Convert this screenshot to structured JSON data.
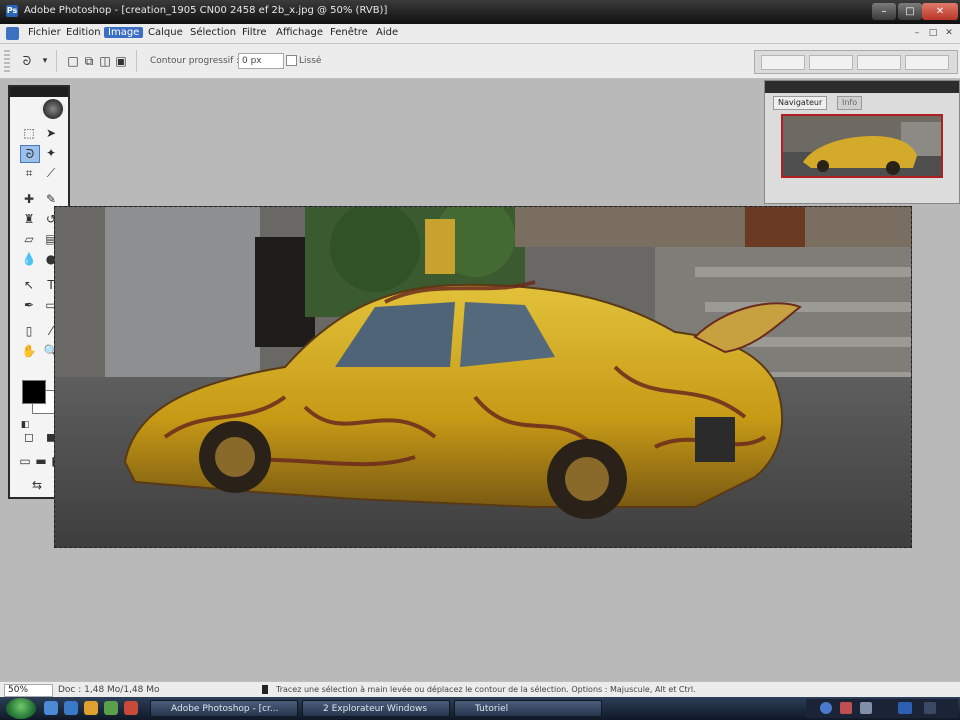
{
  "window": {
    "title": "Adobe Photoshop - [creation_1905 CN00 2458 ef 2b_x.jpg @ 50% (RVB)]",
    "controls": [
      "–",
      "□",
      "✕"
    ]
  },
  "menubar": {
    "items": [
      {
        "label": "Fichier",
        "active": false
      },
      {
        "label": "Edition",
        "active": false
      },
      {
        "label": "Image",
        "active": true
      },
      {
        "label": "Calque",
        "active": false
      },
      {
        "label": "Sélection",
        "active": false
      },
      {
        "label": "Filtre",
        "active": false
      },
      {
        "label": "Affichage",
        "active": false
      },
      {
        "label": "Fenêtre",
        "active": false
      },
      {
        "label": "Aide",
        "active": false
      }
    ]
  },
  "options_bar": {
    "size_label": "Contour progressif :",
    "size_value": "0 px",
    "lissage_label": "Lissé"
  },
  "navigator": {
    "tabs": [
      "Navigateur",
      "Info"
    ]
  },
  "status_bar": {
    "zoom": "50%",
    "doc_info": "Doc : 1,48 Mo/1,48 Mo",
    "hint": "Tracez une sélection à main levée ou déplacez le contour de la sélection. Options : Majuscule, Alt et Ctrl."
  },
  "taskbar": {
    "buttons": [
      "Adobe Photoshop - [cr...",
      "2 Explorateur Windows",
      "Tutoriel"
    ]
  },
  "icons": {
    "toolbox": [
      "marquee-icon",
      "move-icon",
      "lasso-icon",
      "magic-wand-icon",
      "crop-icon",
      "slice-icon",
      "healing-brush-icon",
      "brush-icon",
      "clone-stamp-icon",
      "history-brush-icon",
      "eraser-icon",
      "gradient-icon",
      "blur-icon",
      "dodge-icon",
      "path-selection-icon",
      "type-icon",
      "pen-icon",
      "shape-icon",
      "notes-icon",
      "eyedropper-icon",
      "hand-icon",
      "zoom-icon"
    ]
  },
  "colors": {
    "accent": "#3b6fc4",
    "foreground": "#000000",
    "background": "#ffffff"
  }
}
